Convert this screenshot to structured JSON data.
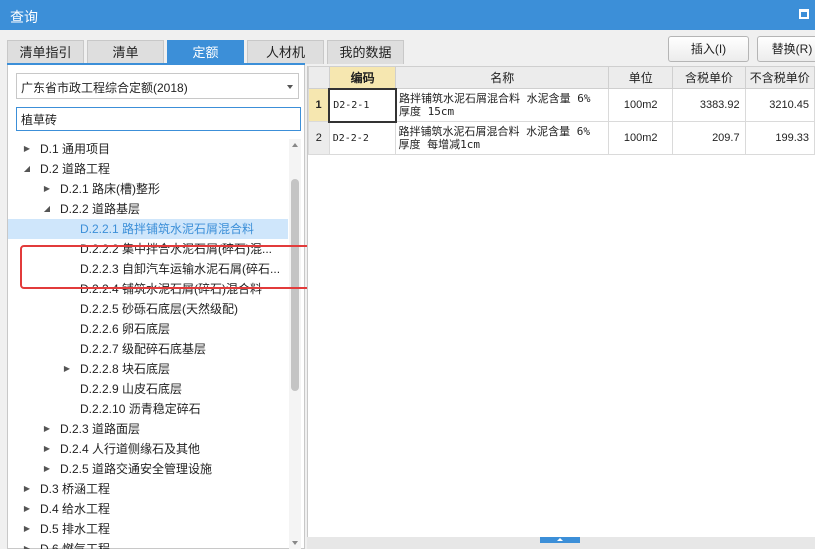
{
  "window": {
    "title": "查询"
  },
  "tabs": [
    {
      "label": "清单指引",
      "active": false
    },
    {
      "label": "清单",
      "active": false
    },
    {
      "label": "定额",
      "active": true
    },
    {
      "label": "人材机",
      "active": false
    },
    {
      "label": "我的数据",
      "active": false
    }
  ],
  "actions": {
    "insert_label": "插入(I)",
    "replace_label": "替换(R)"
  },
  "library_select": {
    "value": "广东省市政工程综合定额(2018)"
  },
  "search": {
    "value": "植草砖"
  },
  "tree": [
    {
      "label": "D.1 通用项目",
      "state": "collapsed",
      "selected": false
    },
    {
      "label": "D.2 道路工程",
      "state": "expanded",
      "selected": false
    },
    {
      "label": "D.2.1 路床(槽)整形",
      "state": "collapsed",
      "selected": false
    },
    {
      "label": "D.2.2 道路基层",
      "state": "expanded",
      "selected": false
    },
    {
      "label": "D.2.2.1 路拌铺筑水泥石屑混合料",
      "state": "leaf",
      "selected": true
    },
    {
      "label": "D.2.2.2 集中拌合水泥石屑(碎石)混...",
      "state": "leaf",
      "selected": false
    },
    {
      "label": "D.2.2.3 自卸汽车运输水泥石屑(碎石...",
      "state": "leaf",
      "selected": false
    },
    {
      "label": "D.2.2.4 铺筑水泥石屑(碎石)混合料",
      "state": "leaf",
      "selected": false
    },
    {
      "label": "D.2.2.5 砂砾石底层(天然级配)",
      "state": "leaf",
      "selected": false
    },
    {
      "label": "D.2.2.6 卵石底层",
      "state": "leaf",
      "selected": false
    },
    {
      "label": "D.2.2.7 级配碎石底基层",
      "state": "leaf",
      "selected": false
    },
    {
      "label": "D.2.2.8 块石底层",
      "state": "collapsed",
      "selected": false
    },
    {
      "label": "D.2.2.9 山皮石底层",
      "state": "leaf",
      "selected": false
    },
    {
      "label": "D.2.2.10 沥青稳定碎石",
      "state": "leaf",
      "selected": false
    },
    {
      "label": "D.2.3 道路面层",
      "state": "collapsed",
      "selected": false
    },
    {
      "label": "D.2.4 人行道侧缘石及其他",
      "state": "collapsed",
      "selected": false
    },
    {
      "label": "D.2.5 道路交通安全管理设施",
      "state": "collapsed",
      "selected": false
    },
    {
      "label": "D.3 桥涵工程",
      "state": "collapsed",
      "selected": false
    },
    {
      "label": "D.4 给水工程",
      "state": "collapsed",
      "selected": false
    },
    {
      "label": "D.5 排水工程",
      "state": "collapsed",
      "selected": false
    },
    {
      "label": "D.6 燃气工程",
      "state": "collapsed",
      "selected": false
    }
  ],
  "grid": {
    "columns": [
      "编码",
      "名称",
      "单位",
      "含税单价",
      "不含税单价"
    ],
    "rows": [
      {
        "no": "1",
        "code": "D2-2-1",
        "name": "路拌铺筑水泥石屑混合料 水泥含量 6% 厚度 15cm",
        "unit": "100m2",
        "price_tax": "3383.92",
        "price_notax": "3210.45"
      },
      {
        "no": "2",
        "code": "D2-2-2",
        "name": "路拌铺筑水泥石屑混合料 水泥含量 6% 厚度 每增减1cm",
        "unit": "100m2",
        "price_tax": "209.7",
        "price_notax": "199.33"
      }
    ]
  },
  "colors": {
    "accent": "#3c8fd8",
    "highlight": "#e23b3b",
    "selection_bg": "#cfe6fb",
    "row_header_selected": "#f6e7b0"
  },
  "icons": {
    "maximize": "maximize-icon",
    "dropdown": "chevron-down-icon",
    "expand": "triangle-right-icon",
    "collapse": "triangle-down-icon"
  }
}
